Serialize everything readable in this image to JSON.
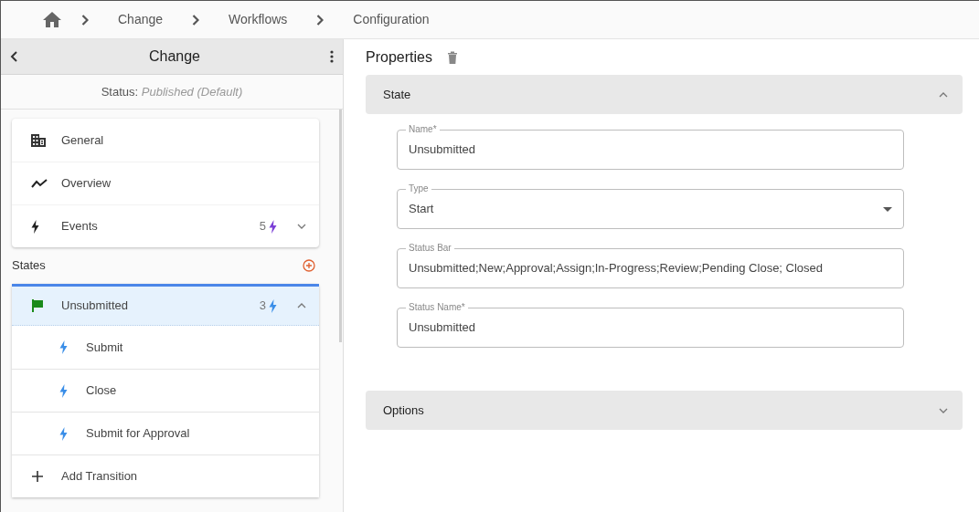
{
  "breadcrumb": [
    "Change",
    "Workflows",
    "Configuration"
  ],
  "panel": {
    "title": "Change",
    "status_label": "Status:",
    "status_value": "Published (Default)",
    "nav": [
      {
        "kind": "building",
        "label": "General"
      },
      {
        "kind": "trend",
        "label": "Overview"
      },
      {
        "kind": "events",
        "label": "Events",
        "count": "5",
        "expanded": false
      }
    ],
    "states_title": "States",
    "states": [
      {
        "name": "Unsubmitted",
        "count": "3",
        "selected": true,
        "expanded": true,
        "transitions": [
          "Submit",
          "Close",
          "Submit for Approval"
        ],
        "add_label": "Add Transition"
      }
    ]
  },
  "properties": {
    "title": "Properties",
    "sections": [
      {
        "title": "State",
        "expanded": true,
        "fields": [
          {
            "kind": "text",
            "label": "Name*",
            "value": "Unsubmitted"
          },
          {
            "kind": "select",
            "label": "Type",
            "value": "Start"
          },
          {
            "kind": "text",
            "label": "Status Bar",
            "value": "Unsubmitted;New;Approval;Assign;In-Progress;Review;Pending Close; Closed"
          },
          {
            "kind": "text",
            "label": "Status Name*",
            "value": "Unsubmitted"
          }
        ]
      },
      {
        "title": "Options",
        "expanded": false
      }
    ]
  }
}
